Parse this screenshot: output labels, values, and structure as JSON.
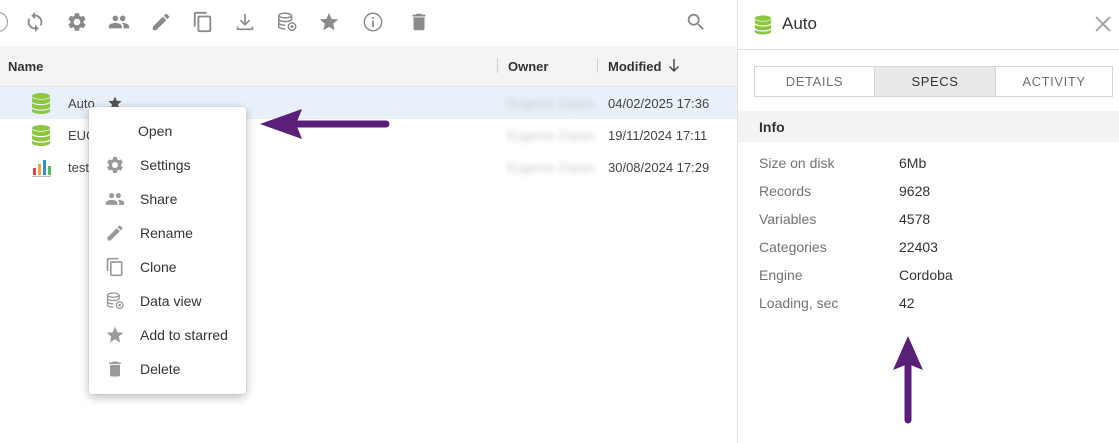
{
  "toolbar": {
    "icons": [
      "refresh-icon",
      "gear-icon",
      "share-icon",
      "pencil-icon",
      "clone-icon",
      "download-icon",
      "data-view-icon",
      "star-icon",
      "info-icon",
      "trash-icon",
      "search-icon"
    ]
  },
  "file_list": {
    "columns": {
      "name": "Name",
      "owner": "Owner",
      "modified": "Modified"
    },
    "sort": "descending",
    "rows": [
      {
        "name": "Auto",
        "icon": "database-icon",
        "owner": "Eugenio Zayas",
        "modified": "04/02/2025 17:36",
        "starred": true,
        "selected": true
      },
      {
        "name": "EUC",
        "icon": "database-icon",
        "owner": "Eugenio Zayas",
        "modified": "19/11/2024 17:11",
        "starred": false,
        "selected": false
      },
      {
        "name": "test",
        "icon": "bar-chart-icon",
        "owner": "Eugenio Zayas",
        "modified": "30/08/2024 17:29",
        "starred": false,
        "selected": false
      }
    ]
  },
  "context_menu": {
    "items": [
      {
        "label": "Open",
        "icon": ""
      },
      {
        "label": "Settings",
        "icon": "gear-icon"
      },
      {
        "label": "Share",
        "icon": "share-icon"
      },
      {
        "label": "Rename",
        "icon": "pencil-icon"
      },
      {
        "label": "Clone",
        "icon": "clone-icon"
      },
      {
        "label": "Data view",
        "icon": "data-view-icon"
      },
      {
        "label": "Add to starred",
        "icon": "star-icon"
      },
      {
        "label": "Delete",
        "icon": "trash-icon"
      }
    ]
  },
  "details_panel": {
    "title": "Auto",
    "tabs": [
      "DETAILS",
      "SPECS",
      "ACTIVITY"
    ],
    "active_tab": "SPECS",
    "section": "Info",
    "specs": [
      {
        "key": "Size on disk",
        "value": "6Mb"
      },
      {
        "key": "Records",
        "value": "9628"
      },
      {
        "key": "Variables",
        "value": "4578"
      },
      {
        "key": "Categories",
        "value": "22403"
      },
      {
        "key": "Engine",
        "value": "Cordoba"
      },
      {
        "key": "Loading, sec",
        "value": "42"
      }
    ]
  },
  "colors": {
    "annotation_arrow": "#5b1f7a",
    "database_green": "#8dc63f",
    "selected_row": "#e8f0f9",
    "icon_gray": "#8a8a8a"
  }
}
